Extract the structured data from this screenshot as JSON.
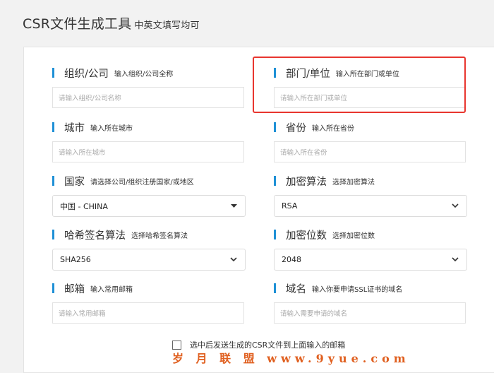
{
  "header": {
    "title": "CSR文件生成工具",
    "subtitle": "中英文填写均可"
  },
  "form": {
    "organization": {
      "label": "组织/公司",
      "hint": "输入组织/公司全称",
      "placeholder": "请输入组织/公司名称",
      "value": ""
    },
    "department": {
      "label": "部门/单位",
      "hint": "输入所在部门或单位",
      "placeholder": "请输入所在部门或单位",
      "value": ""
    },
    "city": {
      "label": "城市",
      "hint": "输入所在城市",
      "placeholder": "请输入所在城市",
      "value": ""
    },
    "province": {
      "label": "省份",
      "hint": "输入所在省份",
      "placeholder": "请输入所在省份",
      "value": ""
    },
    "country": {
      "label": "国家",
      "hint": "请选择公司/组织注册国家/或地区",
      "selected": "中国 - CHINA"
    },
    "algorithm": {
      "label": "加密算法",
      "hint": "选择加密算法",
      "selected": "RSA"
    },
    "hash": {
      "label": "哈希签名算法",
      "hint": "选择哈希签名算法",
      "selected": "SHA256"
    },
    "key_size": {
      "label": "加密位数",
      "hint": "选择加密位数",
      "selected": "2048"
    },
    "email": {
      "label": "邮箱",
      "hint": "输入常用邮箱",
      "placeholder": "请输入常用邮箱",
      "value": ""
    },
    "domain": {
      "label": "域名",
      "hint": "输入你要申请SSL证书的域名",
      "placeholder": "请输入需要申请的域名",
      "value": ""
    },
    "send_email_checkbox": {
      "label": "选中后发送生成的CSR文件到上面输入的邮箱",
      "checked": false
    }
  },
  "watermark": "岁 月 联 盟   www.9yue.com",
  "colors": {
    "accent": "#1e90d6",
    "highlight": "#e8362f",
    "watermark": "#e06020"
  },
  "icons": {
    "select_arrow": "chevron-down-icon"
  }
}
